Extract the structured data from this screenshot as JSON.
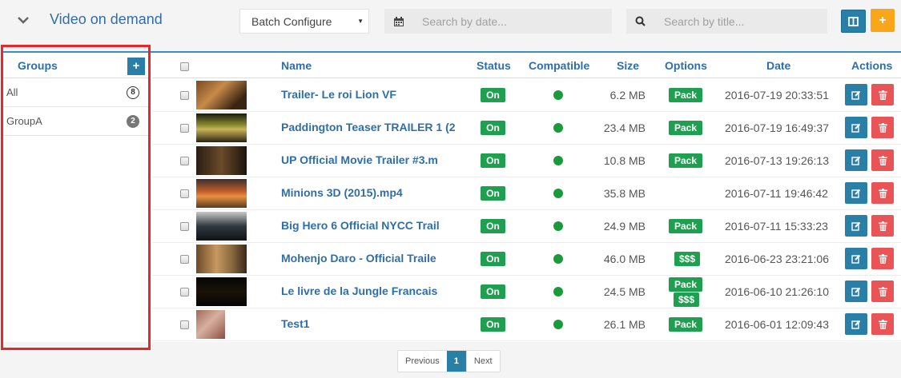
{
  "header": {
    "title": "Video on demand",
    "batch_select": "Batch Configure",
    "date_placeholder": "Search by date...",
    "title_placeholder": "Search by title...",
    "accent": "#2a7fa7",
    "add_color": "#f9a61a",
    "add_label": "+"
  },
  "groups": {
    "title": "Groups",
    "add_label": "+",
    "items": [
      {
        "label": "All",
        "count": "8"
      },
      {
        "label": "GroupA",
        "count": "2"
      }
    ]
  },
  "table": {
    "columns": {
      "name": "Name",
      "status": "Status",
      "compatible": "Compatible",
      "size": "Size",
      "options": "Options",
      "date": "Date",
      "actions": "Actions"
    },
    "rows": [
      {
        "name": "Trailer- Le roi Lion VF",
        "status": "On",
        "size": "6.2 MB",
        "options": [
          "Pack"
        ],
        "date": "2016-07-19 20:33:51"
      },
      {
        "name": "Paddington Teaser TRAILER 1 (2",
        "status": "On",
        "size": "23.4 MB",
        "options": [
          "Pack"
        ],
        "date": "2016-07-19 16:49:37"
      },
      {
        "name": "UP Official Movie Trailer #3.m",
        "status": "On",
        "size": "10.8 MB",
        "options": [
          "Pack"
        ],
        "date": "2016-07-13 19:26:13"
      },
      {
        "name": "Minions 3D (2015).mp4",
        "status": "On",
        "size": "35.8 MB",
        "options": [],
        "date": "2016-07-11 19:46:42"
      },
      {
        "name": "Big Hero 6 Official NYCC Trail",
        "status": "On",
        "size": "24.9 MB",
        "options": [
          "Pack"
        ],
        "date": "2016-07-11 15:33:23"
      },
      {
        "name": "Mohenjo Daro - Official Traile",
        "status": "On",
        "size": "46.0 MB",
        "options": [
          "$$$"
        ],
        "date": "2016-06-23 23:21:06"
      },
      {
        "name": "Le livre de la Jungle Francais",
        "status": "On",
        "size": "24.5 MB",
        "options": [
          "Pack",
          "$$$"
        ],
        "date": "2016-06-10 21:26:10"
      },
      {
        "name": "Test1",
        "status": "On",
        "size": "26.1 MB",
        "options": [
          "Pack"
        ],
        "date": "2016-06-01 12:09:43"
      }
    ]
  },
  "pagination": {
    "previous": "Previous",
    "current": "1",
    "next": "Next"
  }
}
